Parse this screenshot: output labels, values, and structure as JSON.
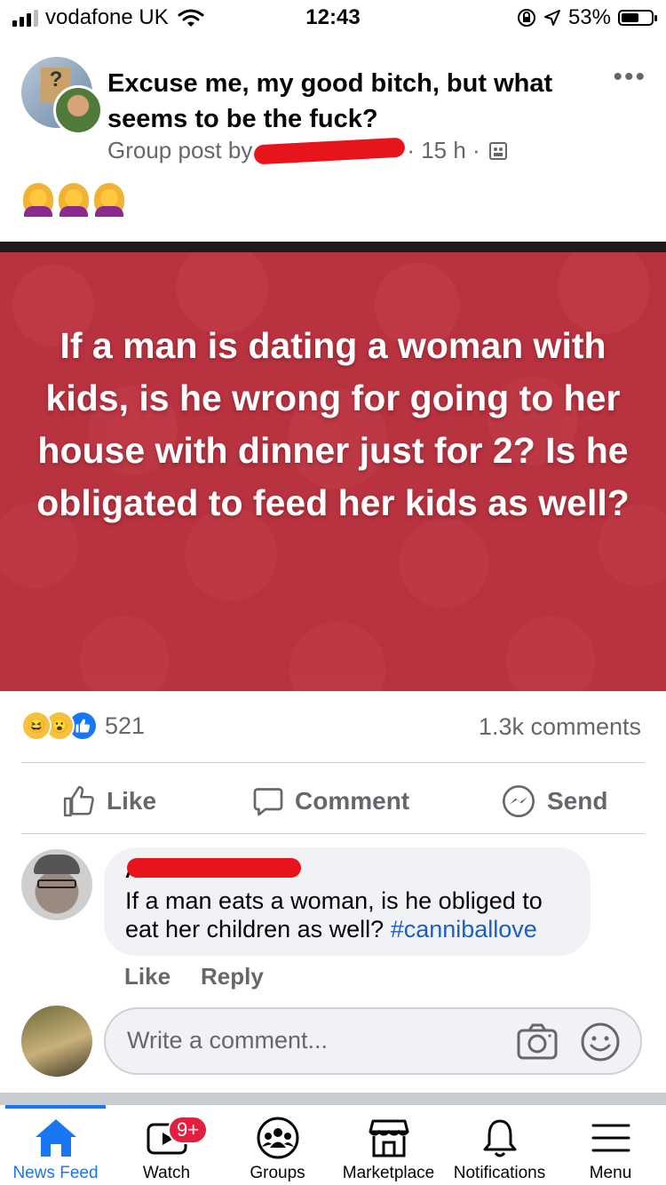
{
  "status_bar": {
    "carrier": "vodafone UK",
    "time": "12:43",
    "battery": "53%"
  },
  "post": {
    "title": "Excuse me, my good bitch, but what seems to be the fuck?",
    "meta_prefix": "Group post by",
    "meta_time": "· 15 h ·",
    "image_text": "If a man is dating a woman with kids, is he wrong for going to her house with dinner just for 2? Is he obligated to feed her kids as well?",
    "reaction_count": "521",
    "comment_count": "1.3k comments"
  },
  "actions": {
    "like": "Like",
    "comment": "Comment",
    "send": "Send"
  },
  "comment": {
    "author_partial": "Ant",
    "text_plain": "If a man eats a woman, is he obliged to eat her children as well?",
    "hashtag": "#canniballove",
    "like": "Like",
    "reply": "Reply"
  },
  "composer": {
    "placeholder": "Write a comment..."
  },
  "tabbar": {
    "items": [
      {
        "label": "News Feed",
        "icon": "home-icon",
        "active": true
      },
      {
        "label": "Watch",
        "icon": "video-icon",
        "badge": "9+"
      },
      {
        "label": "Groups",
        "icon": "groups-icon"
      },
      {
        "label": "Marketplace",
        "icon": "shop-icon"
      },
      {
        "label": "Notifications",
        "icon": "bell-icon"
      },
      {
        "label": "Menu",
        "icon": "hamburger-icon"
      }
    ]
  },
  "colors": {
    "accent": "#1877f2",
    "image_bg": "#b8323f",
    "redaction": "#e8141c"
  }
}
